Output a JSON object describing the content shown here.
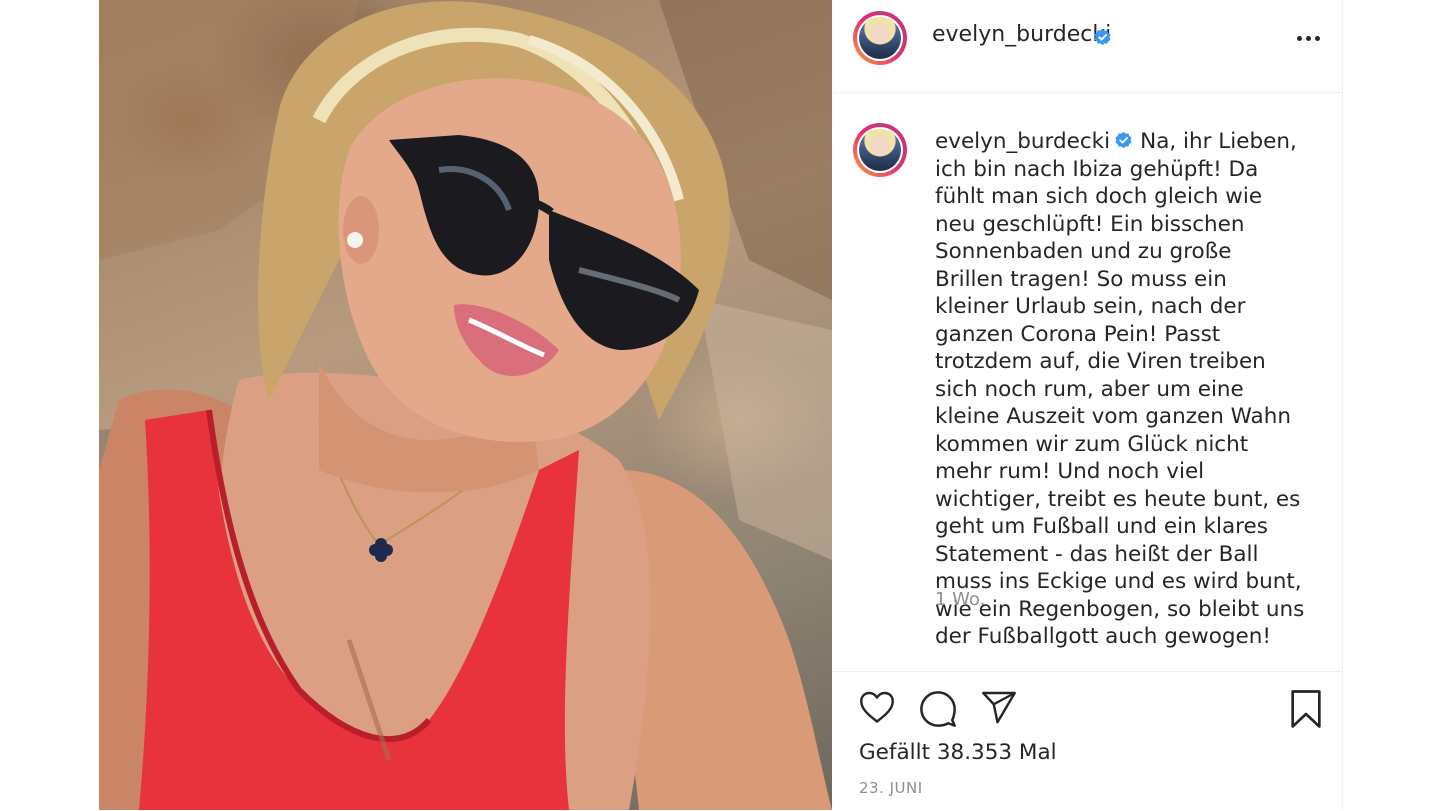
{
  "post": {
    "username": "evelyn_burdecki",
    "verified_icon": "verified-badge-icon",
    "caption": "Na, ihr Lieben, ich bin nach Ibiza gehüpft! Da fühlt man sich doch gleich wie neu geschlüpft! Ein bisschen Sonnenbaden und zu große Brillen tragen! So muss ein kleiner Urlaub sein, nach der ganzen Corona Pein! Passt trotzdem auf, die Viren treiben sich noch rum, aber um eine kleine Auszeit vom ganzen Wahn kommen wir zum Glück nicht mehr rum! Und noch viel wichtiger, treibt es heute bunt, es geht um Fußball und ein klares Statement - das heißt der Ball muss ins Eckige und es wird bunt, wie ein Regenbogen, so bleibt uns der Fußballgott auch gewogen!",
    "time_ago": "1 Wo.",
    "likes": "Gefällt 38.353 Mal",
    "date": "23. JUNI"
  },
  "colors": {
    "verified": "#3897f0",
    "text": "#262626",
    "muted": "#8e8e8e",
    "divider": "#efefef",
    "swimsuit": "#e8323c"
  },
  "icons": [
    "heart-icon",
    "comment-icon",
    "share-icon",
    "bookmark-icon",
    "more-options-icon"
  ]
}
